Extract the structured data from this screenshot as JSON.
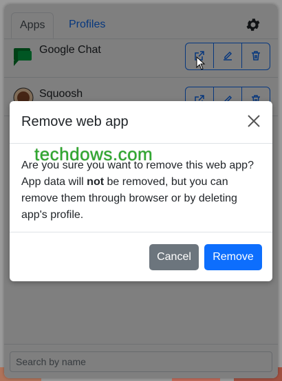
{
  "tabs": {
    "apps": "Apps",
    "profiles": "Profiles"
  },
  "apps": [
    {
      "name": "Google Chat"
    },
    {
      "name": "Squoosh"
    }
  ],
  "search": {
    "placeholder": "Search by name"
  },
  "dialog": {
    "title": "Remove web app",
    "body_before": "Are you sure you want to remove this web app? App data will ",
    "body_bold": "not",
    "body_after": " be removed, but you can remove them through browser or by deleting app's profile.",
    "cancel_label": "Cancel",
    "remove_label": "Remove"
  },
  "watermark": "techdows.com",
  "colors": {
    "primary": "#0d6efd",
    "secondary": "#6c757d",
    "watermark": "#2fa92f"
  }
}
